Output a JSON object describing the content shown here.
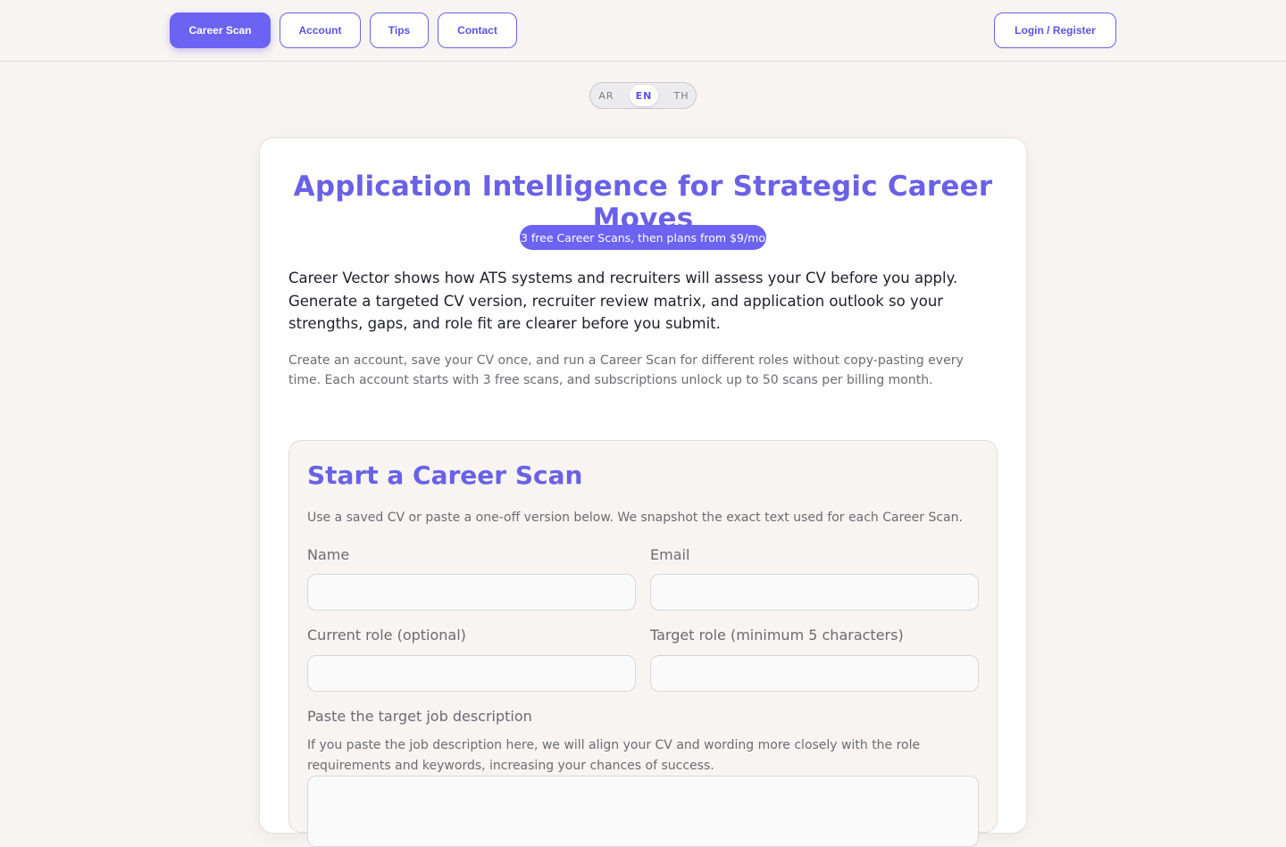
{
  "nav": {
    "items": [
      {
        "label": "Career Scan",
        "active": true
      },
      {
        "label": "Account",
        "active": false
      },
      {
        "label": "Tips",
        "active": false
      },
      {
        "label": "Contact",
        "active": false
      }
    ],
    "auth_label": "Login / Register"
  },
  "language": {
    "options": [
      "AR",
      "EN",
      "TH"
    ],
    "selected": "EN"
  },
  "hero": {
    "title": "Application Intelligence for Strategic Career Moves",
    "badge": "3 free Career Scans, then plans from $9/mo",
    "lead": "Career Vector shows how ATS systems and recruiters will assess your CV before you apply. Generate a targeted CV version, recruiter review matrix, and application outlook so your strengths, gaps, and role fit are clearer before you submit.",
    "sub": "Create an account, save your CV once, and run a Career Scan for different roles without copy-pasting every time. Each account starts with 3 free scans, and subscriptions unlock up to 50 scans per billing month."
  },
  "scan": {
    "title": "Start a Career Scan",
    "description": "Use a saved CV or paste a one-off version below. We snapshot the exact text used for each Career Scan.",
    "fields": {
      "name": {
        "label": "Name",
        "value": ""
      },
      "email": {
        "label": "Email",
        "value": ""
      },
      "current_role": {
        "label": "Current role (optional)",
        "value": ""
      },
      "target_role": {
        "label": "Target role (minimum 5 characters)",
        "value": ""
      }
    },
    "job_description": {
      "label": "Paste the target job description",
      "help": "If you paste the job description here, we will align your CV and wording more closely with the role requirements and keywords, increasing your chances of success.",
      "value": ""
    }
  },
  "colors": {
    "accent": "#6c63f2",
    "background": "#f7f4f1",
    "card": "#ffffff"
  }
}
